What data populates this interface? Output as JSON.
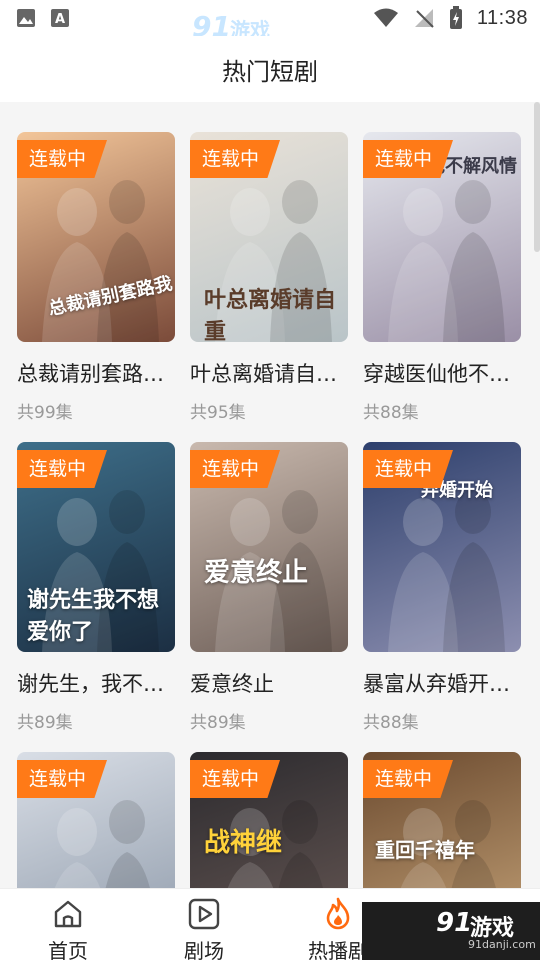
{
  "status_bar": {
    "time": "11:38"
  },
  "watermark": {
    "logo": "91游戏",
    "num": "91",
    "cn": "游戏",
    "url": "91danji.com"
  },
  "header": {
    "title": "热门短剧"
  },
  "badge_label": "连载中",
  "dramas": [
    {
      "title": "总裁请别套路…",
      "count": "共99集",
      "poster_text": "总裁请别套路我",
      "colors": [
        "#f3c69a",
        "#7b4b3a"
      ]
    },
    {
      "title": "叶总离婚请自…",
      "count": "共95集",
      "poster_text": "叶总离婚请自重",
      "colors": [
        "#e9e2d8",
        "#b9c4c8"
      ]
    },
    {
      "title": "穿越医仙他不…",
      "count": "共88集",
      "poster_text": "医仙他不解风情",
      "colors": [
        "#e6e8ee",
        "#9a8fa6"
      ]
    },
    {
      "title": "谢先生，我不…",
      "count": "共89集",
      "poster_text": "谢先生我不想爱你了",
      "colors": [
        "#3e6f8a",
        "#1c2f43"
      ]
    },
    {
      "title": "爱意终止",
      "count": "共89集",
      "poster_text": "爱意终止",
      "colors": [
        "#c9b9ae",
        "#6e5f58"
      ]
    },
    {
      "title": "暴富从弃婚开…",
      "count": "共88集",
      "poster_text": "弃婚开始",
      "colors": [
        "#2d3f6c",
        "#8d8fb0"
      ]
    },
    {
      "title": "",
      "count": "",
      "poster_text": "",
      "colors": [
        "#d9dee6",
        "#8c98a8"
      ]
    },
    {
      "title": "",
      "count": "",
      "poster_text": "战神继",
      "colors": [
        "#2b2a2e",
        "#6a5a56"
      ]
    },
    {
      "title": "",
      "count": "",
      "poster_text": "重回千禧年",
      "colors": [
        "#6b4a2f",
        "#c7a57a"
      ]
    }
  ],
  "bottom_nav": [
    {
      "label": "首页",
      "icon": "home-icon",
      "active": false
    },
    {
      "label": "剧场",
      "icon": "play-icon",
      "active": false
    },
    {
      "label": "热播剧",
      "icon": "flame-icon",
      "active": true
    }
  ],
  "colors": {
    "accent": "#ff7a17",
    "background": "#f5f5f5"
  }
}
